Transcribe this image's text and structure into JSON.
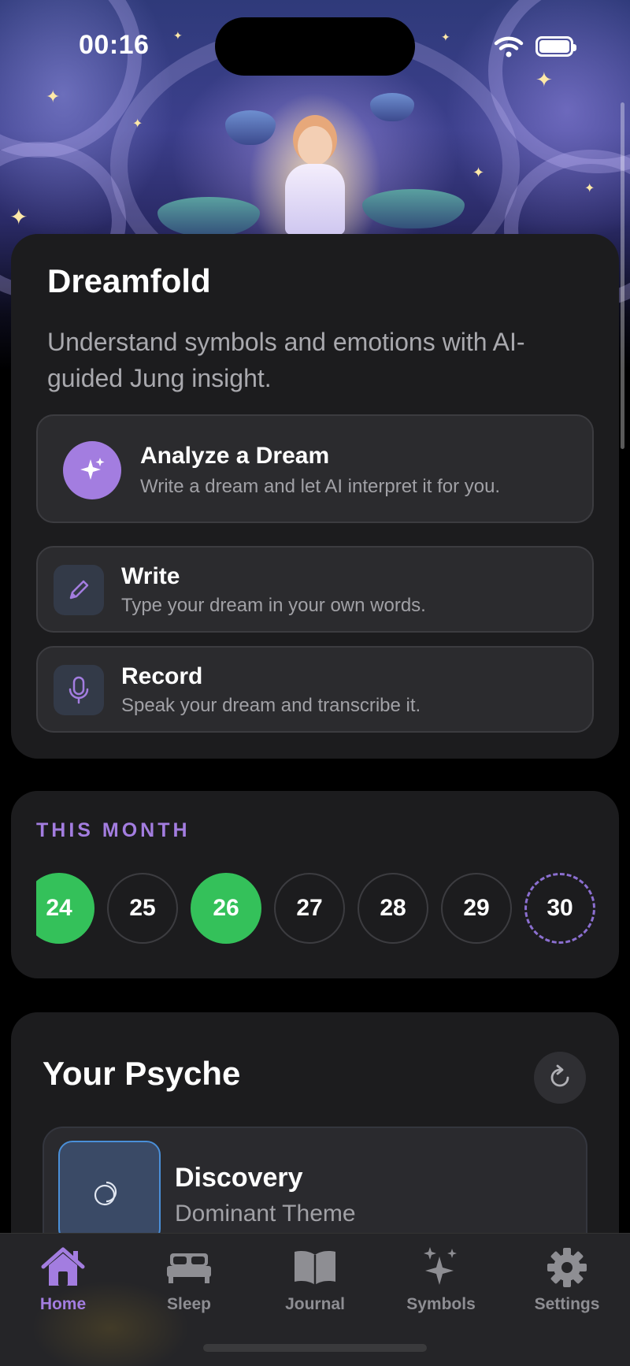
{
  "status_bar": {
    "time": "00:16"
  },
  "header": {
    "app_title": "Dreamfold",
    "subtitle": "Understand symbols and emotions with AI-guided Jung insight."
  },
  "actions": {
    "analyze": {
      "title": "Analyze a Dream",
      "description": "Write a dream and let AI interpret it for you.",
      "icon": "sparkles-icon"
    },
    "write": {
      "title": "Write",
      "description": "Type your dream in your own words.",
      "icon": "pencil-icon"
    },
    "record": {
      "title": "Record",
      "description": "Speak your dream and transcribe it.",
      "icon": "microphone-icon"
    }
  },
  "month": {
    "label": "THIS MONTH",
    "days": [
      {
        "day": "24",
        "state": "logged"
      },
      {
        "day": "25",
        "state": "empty"
      },
      {
        "day": "26",
        "state": "logged"
      },
      {
        "day": "27",
        "state": "empty"
      },
      {
        "day": "28",
        "state": "empty"
      },
      {
        "day": "29",
        "state": "empty"
      },
      {
        "day": "30",
        "state": "today"
      }
    ]
  },
  "psyche": {
    "title": "Your Psyche",
    "theme": {
      "title": "Discovery",
      "subtitle": "Dominant Theme"
    }
  },
  "tabs": [
    {
      "label": "Home",
      "icon": "house-icon",
      "active": true
    },
    {
      "label": "Sleep",
      "icon": "bed-icon",
      "active": false
    },
    {
      "label": "Journal",
      "icon": "book-icon",
      "active": false
    },
    {
      "label": "Symbols",
      "icon": "sparkles-icon",
      "active": false
    },
    {
      "label": "Settings",
      "icon": "gear-icon",
      "active": false
    }
  ],
  "colors": {
    "accent": "#a37de0",
    "logged_day": "#34c15a",
    "card_bg": "#1c1c1e",
    "background": "#000000"
  }
}
